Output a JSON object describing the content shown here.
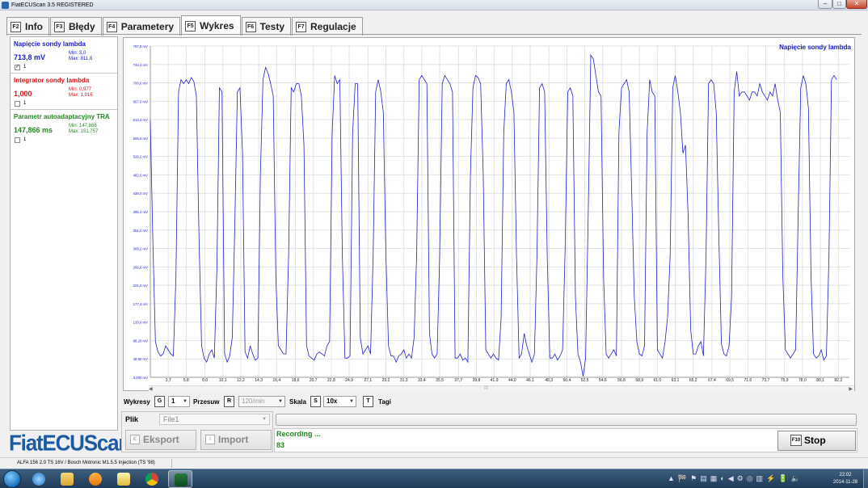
{
  "window": {
    "title": "FiatECUScan 3.5 REGISTERED",
    "minimize": "–",
    "maximize": "□",
    "close": "✕"
  },
  "tabs": [
    {
      "key": "F2",
      "label": "Info"
    },
    {
      "key": "F3",
      "label": "Błędy"
    },
    {
      "key": "F4",
      "label": "Parametery"
    },
    {
      "key": "F5",
      "label": "Wykres",
      "active": true
    },
    {
      "key": "F6",
      "label": "Testy"
    },
    {
      "key": "F7",
      "label": "Regulacje"
    }
  ],
  "params": [
    {
      "name": "Napięcie sondy lambda",
      "value": "713,8 mV",
      "min": "Min: 3,0",
      "max": "Max: 811,8",
      "checked": true,
      "index": "1",
      "color": "#1a1acc"
    },
    {
      "name": "Integrator sondy lambda",
      "value": "1,000",
      "min": "Min: 0,977",
      "max": "Max: 1,016",
      "checked": false,
      "index": "1",
      "color": "#dd1111"
    },
    {
      "name": "Parametr autoadaptacyjny TRA",
      "value": "147,866 ms",
      "min": "Min: 147,866",
      "max": "Max: 151,757",
      "checked": false,
      "index": "1",
      "color": "#22881f"
    }
  ],
  "logo": "FiatECUScan",
  "chart_data": {
    "type": "line",
    "series_name": "Napięcie sondy lambda",
    "series_color": "#2222cc",
    "y_ticks": [
      "3,000 mV",
      "48,60 mV",
      "88,20 mV",
      "133,0 mV",
      "177,4 mV",
      "221,0 mV",
      "266,8 mV",
      "308,2 mV",
      "351,0 mV",
      "395,4 mV",
      "439,0 mV",
      "482,6 mV",
      "526,2 mV",
      "569,8 mV",
      "613,4 mV",
      "657,0 mV",
      "700,6 mV",
      "744,2 mV",
      "787,8 mV"
    ],
    "x_ticks": [
      "3,7",
      "5,8",
      "8,0",
      "10,1",
      "12,2",
      "14,3",
      "16,4",
      "18,6",
      "20,7",
      "22,8",
      "24,9",
      "27,1",
      "29,2",
      "31,3",
      "33,4",
      "35,5",
      "37,7",
      "39,8",
      "41,9",
      "44,0",
      "46,1",
      "48,3",
      "50,4",
      "52,5",
      "54,6",
      "56,8",
      "58,9",
      "61,0",
      "63,1",
      "65,2",
      "67,4",
      "69,5",
      "71,6",
      "73,7",
      "75,9",
      "78,0",
      "80,1",
      "82,2"
    ],
    "ylim": [
      3,
      812
    ],
    "x": [
      1.6,
      1.9,
      2.2,
      2.5,
      2.8,
      3.1,
      3.4,
      3.7,
      4.0,
      4.3,
      4.6,
      4.9,
      5.2,
      5.5,
      5.8,
      6.1,
      6.4,
      6.7,
      7.0,
      7.3,
      7.6,
      7.9,
      8.2,
      8.5,
      8.8,
      9.1,
      9.4,
      9.7,
      10.0,
      10.3,
      10.6,
      10.9,
      11.2,
      11.5,
      11.8,
      12.1,
      12.4,
      12.7,
      13.0,
      13.3,
      13.6,
      13.9,
      14.2,
      14.5,
      14.8,
      15.1,
      15.4,
      15.7,
      16.0,
      16.3,
      16.6,
      16.9,
      17.2,
      17.5,
      17.8,
      18.1,
      18.4,
      18.7,
      19.0,
      19.3,
      19.6,
      19.9,
      20.2,
      20.5,
      20.8,
      21.1,
      21.4,
      21.7,
      22.0,
      22.3,
      22.6,
      22.9,
      23.2,
      23.5,
      23.8,
      24.1,
      24.4,
      24.7,
      25.0,
      25.3,
      25.6,
      25.9,
      26.2,
      26.5,
      26.8,
      27.1,
      27.4,
      27.7,
      28.0,
      28.3,
      28.6,
      28.9,
      29.2,
      29.5,
      29.8,
      30.1,
      30.4,
      30.7,
      31.0,
      31.3,
      31.6,
      31.9,
      32.2,
      32.5,
      32.8,
      33.1,
      33.4,
      33.7,
      34.0,
      34.3,
      34.6,
      34.9,
      35.2,
      35.5,
      35.8,
      36.1,
      36.4,
      36.7,
      37.0,
      37.3,
      37.6,
      37.9,
      38.2,
      38.5,
      38.8,
      39.1,
      39.4,
      39.7,
      40.0,
      40.3,
      40.6,
      40.9,
      41.2,
      41.5,
      41.8,
      42.1,
      42.4,
      42.7,
      43.0,
      43.3,
      43.6,
      43.9,
      44.2,
      44.5,
      44.8,
      45.1,
      45.4,
      45.7,
      46.0,
      46.3,
      46.6,
      46.9,
      47.2,
      47.5,
      47.8,
      48.1,
      48.4,
      48.7,
      49.0,
      49.3,
      49.6,
      49.9,
      50.2,
      50.5,
      50.8,
      51.1,
      51.4,
      51.7,
      52.0,
      52.3,
      52.6,
      52.9,
      53.2,
      53.5,
      53.8,
      54.1,
      54.4,
      54.7,
      55.0,
      55.3,
      55.6,
      55.9,
      56.2,
      56.5,
      56.8,
      57.1,
      57.4,
      57.7,
      58.0,
      58.3,
      58.6,
      58.9,
      59.2,
      59.5,
      59.8,
      60.1,
      60.4,
      60.7,
      61.0,
      61.3,
      61.6,
      61.9,
      62.2,
      62.5,
      62.8,
      63.1,
      63.4,
      63.7,
      64.0,
      64.3,
      64.6,
      64.9,
      65.2,
      65.5,
      65.8,
      66.1,
      66.4,
      66.7,
      67.0,
      67.3,
      67.6,
      67.9,
      68.2,
      68.5,
      68.8,
      69.1,
      69.4,
      69.7,
      70.0,
      70.3,
      70.6,
      70.9,
      71.2,
      71.5,
      71.8,
      72.1,
      72.4,
      72.7,
      73.0,
      73.3,
      73.6,
      73.9,
      74.2,
      74.5,
      74.8,
      75.1,
      75.4,
      75.7,
      76.0,
      76.3,
      76.6,
      76.9,
      77.2,
      77.5,
      77.8,
      78.1,
      78.4,
      78.7,
      79.0,
      79.3,
      79.6,
      79.9,
      80.2,
      80.5,
      80.8,
      81.1,
      81.4,
      81.7,
      82.0,
      82.3,
      82.6,
      82.9,
      83.2,
      83.5
    ],
    "y": [
      630,
      330,
      90,
      65,
      55,
      60,
      80,
      70,
      60,
      55,
      250,
      700,
      730,
      720,
      730,
      720,
      735,
      725,
      690,
      350,
      80,
      50,
      40,
      60,
      70,
      50,
      270,
      710,
      700,
      60,
      40,
      55,
      100,
      380,
      700,
      710,
      550,
      65,
      50,
      80,
      60,
      45,
      50,
      500,
      730,
      760,
      745,
      720,
      690,
      250,
      80,
      70,
      60,
      60,
      300,
      710,
      700,
      720,
      720,
      690,
      570,
      80,
      55,
      50,
      45,
      60,
      65,
      60,
      55,
      80,
      90,
      600,
      740,
      720,
      730,
      300,
      50,
      50,
      55,
      600,
      720,
      720,
      100,
      60,
      70,
      80,
      60,
      300,
      700,
      730,
      700,
      650,
      300,
      80,
      55,
      55,
      40,
      55,
      60,
      70,
      50,
      60,
      50,
      100,
      300,
      730,
      740,
      730,
      720,
      110,
      60,
      50,
      60,
      300,
      720,
      740,
      730,
      720,
      700,
      50,
      50,
      60,
      45,
      50,
      40,
      500,
      710,
      740,
      735,
      720,
      500,
      70,
      60,
      50,
      60,
      50,
      45,
      150,
      600,
      720,
      730,
      700,
      650,
      300,
      50,
      60,
      110,
      80,
      60,
      40,
      60,
      300,
      710,
      720,
      700,
      300,
      50,
      50,
      60,
      45,
      55,
      70,
      320,
      700,
      710,
      690,
      200,
      60,
      40,
      5,
      50,
      400,
      790,
      780,
      740,
      700,
      690,
      250,
      60,
      50,
      60,
      70,
      55,
      600,
      710,
      720,
      730,
      700,
      450,
      200,
      90,
      60,
      55,
      80,
      600,
      730,
      700,
      690,
      70,
      60,
      50,
      90,
      150,
      300,
      710,
      740,
      700,
      650,
      550,
      570,
      400,
      120,
      60,
      60,
      80,
      90,
      55,
      300,
      720,
      730,
      720,
      650,
      350,
      85,
      60,
      55,
      80,
      200,
      700,
      750,
      690,
      700,
      700,
      690,
      680,
      700,
      700,
      690,
      720,
      700,
      690,
      680,
      700,
      690,
      720,
      680,
      650,
      250,
      70,
      60,
      50,
      60,
      70,
      400,
      710,
      740,
      720,
      660,
      250,
      60,
      50,
      55,
      70,
      45,
      55,
      300,
      730,
      740,
      730
    ],
    "legend": "Napięcie sondy lambda"
  },
  "controls": {
    "wykresy_label": "Wykresy",
    "wykresy_key": "G",
    "wykresy_value": "1",
    "przesuw_label": "Przesuw",
    "przesuw_key": "R",
    "przesuw_value": "120/min",
    "skala_label": "Skala",
    "skala_key": "S",
    "skala_value": "10x",
    "tagi_key": "T",
    "tagi_label": "Tagi"
  },
  "file": {
    "label": "Plik",
    "combo_value": "File1",
    "export_key": "E",
    "export_label": "Eksport",
    "import_key": "I",
    "import_label": "Import"
  },
  "recording": {
    "status": "Recording ...",
    "count": "83"
  },
  "stop": {
    "key": "F10",
    "label": "Stop"
  },
  "statusbar": {
    "text": "ALFA 156 2.0 TS 16V / Bosch Motronic M1.5.5 Injection (TS '98)"
  },
  "taskbar": {
    "clock_time": "22:02",
    "clock_date": "2014-11-28",
    "tray": [
      "▲",
      "🏁",
      "⚑",
      "▤",
      "▦",
      "◐",
      "◀",
      "⚙",
      "◎",
      "▥",
      "⚡",
      "🔋",
      "🔈"
    ]
  }
}
